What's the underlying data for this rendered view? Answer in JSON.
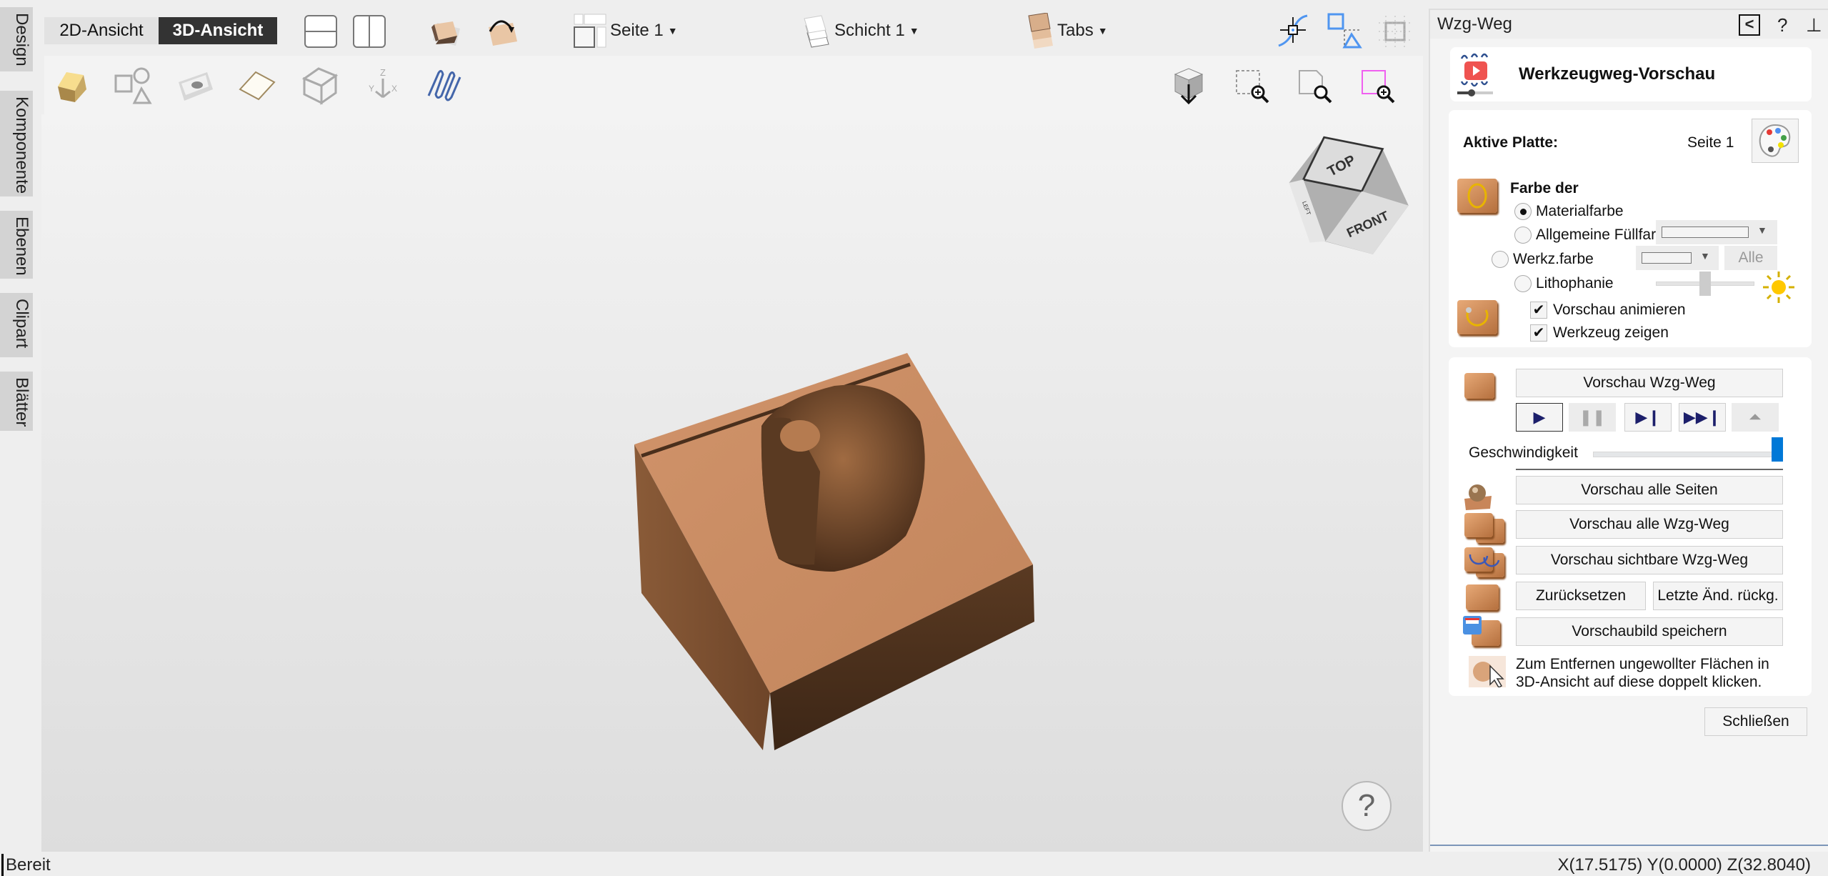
{
  "left_tabs": [
    "Design",
    "Komponente",
    "Ebenen",
    "Clipart",
    "Blätter"
  ],
  "top_toolbar": {
    "view_2d": "2D-Ansicht",
    "view_3d": "3D-Ansicht",
    "active_view": "3D-Ansicht",
    "sheet_dropdown": "Seite 1",
    "layer_dropdown": "Schicht 1",
    "tabs_dropdown": "Tabs",
    "icons": [
      "split-horizontal-icon",
      "split-vertical-icon",
      "material-block-icon",
      "flip-job-icon",
      "sheet-icon",
      "layer-icon",
      "tabs-icon",
      "snap-icon",
      "transform-icon",
      "grid-icon"
    ]
  },
  "icon_toolbar": {
    "left_icons": [
      "material-solid-icon",
      "vectors-icon",
      "background-image-icon",
      "sheet-plane-icon",
      "wireframe-icon",
      "axes-icon",
      "toolpaths-icon"
    ],
    "right_icons": [
      "view-down-icon",
      "zoom-box-icon",
      "zoom-page-icon",
      "zoom-selection-icon"
    ]
  },
  "viewport": {
    "view_cube": {
      "top": "TOP",
      "front": "FRONT",
      "left": "LEFT"
    },
    "help_label": "?"
  },
  "panel": {
    "title": "Wzg-Weg",
    "header_title": "Werkzeugweg-Vorschau",
    "active_plate_label": "Aktive Platte:",
    "active_plate_value": "Seite 1",
    "color_section_label": "Farbe der",
    "color_options": [
      {
        "label": "Materialfarbe",
        "selected": true
      },
      {
        "label": "Allgemeine Füllfarbe",
        "selected": false
      },
      {
        "label": "Werkz.farbe",
        "selected": false
      },
      {
        "label": "Lithophanie",
        "selected": false
      }
    ],
    "all_button": "Alle",
    "lithophane_level": 0.5,
    "animate_preview": {
      "label": "Vorschau animieren",
      "checked": true
    },
    "show_tool": {
      "label": "Werkzeug zeigen",
      "checked": true
    },
    "preview_toolpath_button": "Vorschau Wzg-Weg",
    "playback": [
      "play",
      "pause",
      "step",
      "fast-forward",
      "to-top"
    ],
    "speed_label": "Geschwindigkeit",
    "speed_level": 1.0,
    "preview_all_sheets_button": "Vorschau alle Seiten",
    "preview_all_toolpaths_button": "Vorschau alle Wzg-Weg",
    "preview_visible_toolpaths_button": "Vorschau sichtbare Wzg-Weg",
    "reset_button": "Zurücksetzen",
    "undo_last_button": "Letzte Änd. rückg.",
    "save_preview_button": "Vorschaubild speichern",
    "hint_line1": "Zum Entfernen ungewollter Flächen in",
    "hint_line2": "3D-Ansicht auf diese doppelt klicken.",
    "close_button": "Schließen"
  },
  "statusbar": {
    "status": "Bereit",
    "coordinates": "X(17.5175) Y(0.0000) Z(32.8040)"
  },
  "colors": {
    "active_view_bg": "#333333",
    "speed_thumb": "#0078d7",
    "wood": "#c8865a",
    "playback_icon": "#1c1f6b"
  }
}
